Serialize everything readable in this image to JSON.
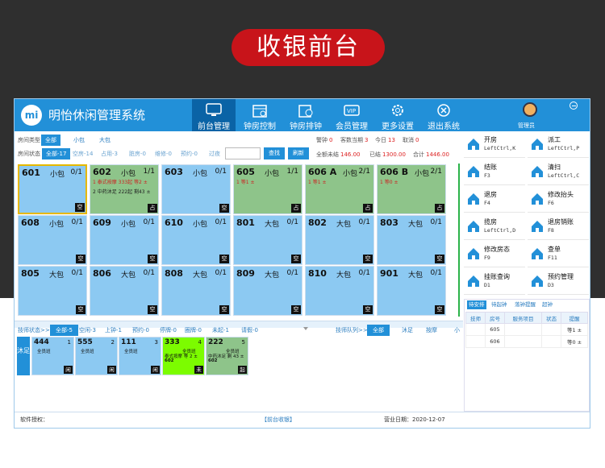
{
  "banner": "收银前台",
  "app": {
    "logo": "mi",
    "title": "明怡休闲管理系统",
    "manager": "管理员"
  },
  "nav": [
    {
      "label": "前台管理",
      "icon": "monitor-icon"
    },
    {
      "label": "钟房控制",
      "icon": "calendar-icon"
    },
    {
      "label": "钟房排钟",
      "icon": "schedule-icon"
    },
    {
      "label": "会员管理",
      "icon": "vip-icon"
    },
    {
      "label": "更多设置",
      "icon": "gear-icon"
    },
    {
      "label": "退出系统",
      "icon": "close-icon"
    }
  ],
  "filters": {
    "type_label": "房间类型",
    "types": [
      "全部",
      "小包",
      "大包"
    ],
    "status_label": "房间状态",
    "statuses": [
      "全部-17",
      "空房-14",
      "占用-3",
      "脏房-0",
      "维修-0",
      "预约-0",
      "过夜"
    ],
    "search_label": "查找",
    "refresh_label": "刷新",
    "alerts": [
      {
        "label": "警钟",
        "value": "0"
      },
      {
        "label": "客数当期",
        "value": "3"
      },
      {
        "label": "今日",
        "value": "13"
      },
      {
        "label": "取消",
        "value": "0"
      }
    ],
    "totals": [
      {
        "label": "全额未结",
        "value": "146.00"
      },
      {
        "label": "已结",
        "value": "1300.00"
      },
      {
        "label": "合计",
        "value": "1446.00"
      }
    ]
  },
  "rooms": [
    {
      "no": "601",
      "type": "小包",
      "cap": "0/1",
      "status": "空",
      "lines": []
    },
    {
      "no": "602",
      "type": "小包",
      "cap": "1/1",
      "status": "占",
      "lines": [
        {
          "text": "1 泰式按摩  333起  等2 ±",
          "red": true
        },
        {
          "text": "2 中药沐足  222起  剩43 ±",
          "red": false
        }
      ]
    },
    {
      "no": "603",
      "type": "小包",
      "cap": "0/1",
      "status": "空",
      "lines": []
    },
    {
      "no": "605",
      "type": "小包",
      "cap": "1/1",
      "status": "占",
      "lines": [
        {
          "text": "1 等1 ±",
          "red": true
        }
      ]
    },
    {
      "no": "606 A",
      "type": "小包",
      "cap": "2/1",
      "status": "占",
      "lines": [
        {
          "text": "1 等1 ±",
          "red": true
        }
      ]
    },
    {
      "no": "606 B",
      "type": "小包",
      "cap": "2/1",
      "status": "占",
      "lines": [
        {
          "text": "1 等0 ±",
          "red": true
        }
      ]
    },
    {
      "no": "608",
      "type": "小包",
      "cap": "0/1",
      "status": "空",
      "lines": []
    },
    {
      "no": "609",
      "type": "小包",
      "cap": "0/1",
      "status": "空",
      "lines": []
    },
    {
      "no": "610",
      "type": "小包",
      "cap": "0/1",
      "status": "空",
      "lines": []
    },
    {
      "no": "801",
      "type": "大包",
      "cap": "0/1",
      "status": "空",
      "lines": []
    },
    {
      "no": "802",
      "type": "大包",
      "cap": "0/1",
      "status": "空",
      "lines": []
    },
    {
      "no": "803",
      "type": "大包",
      "cap": "0/1",
      "status": "空",
      "lines": []
    },
    {
      "no": "805",
      "type": "大包",
      "cap": "0/1",
      "status": "空",
      "lines": []
    },
    {
      "no": "806",
      "type": "大包",
      "cap": "0/1",
      "status": "空",
      "lines": []
    },
    {
      "no": "808",
      "type": "大包",
      "cap": "0/1",
      "status": "空",
      "lines": []
    },
    {
      "no": "809",
      "type": "大包",
      "cap": "0/1",
      "status": "空",
      "lines": []
    },
    {
      "no": "810",
      "type": "大包",
      "cap": "0/1",
      "status": "空",
      "lines": []
    },
    {
      "no": "901",
      "type": "大包",
      "cap": "0/1",
      "status": "空",
      "lines": []
    }
  ],
  "actions": [
    {
      "name": "开房",
      "key": "LeftCtrl,K",
      "icon": "house-icon"
    },
    {
      "name": "派工",
      "key": "LeftCtrl,P",
      "icon": "worker-icon"
    },
    {
      "name": "结账",
      "key": "F3",
      "icon": "yen-icon"
    },
    {
      "name": "清扫",
      "key": "LeftCtrl,C",
      "icon": "broom-icon"
    },
    {
      "name": "退房",
      "key": "F4",
      "icon": "undo-icon"
    },
    {
      "name": "修改抬头",
      "key": "F6",
      "icon": "edit-icon"
    },
    {
      "name": "揽房",
      "key": "LeftCtrl,D",
      "icon": "handshake-icon"
    },
    {
      "name": "退房销账",
      "key": "F8",
      "icon": "house-user-icon"
    },
    {
      "name": "修改房态",
      "key": "F9",
      "icon": "house-edit-icon"
    },
    {
      "name": "查单",
      "key": "F11",
      "icon": "search-doc-icon"
    },
    {
      "name": "挂账查询",
      "key": "D1",
      "icon": "grid-icon"
    },
    {
      "name": "预约管理",
      "key": "D3",
      "icon": "book-icon"
    }
  ],
  "tech_filter": {
    "label": "技师状态>>",
    "statuses": [
      "全部-5",
      "空闲-3",
      "上钟-1",
      "预约-0",
      "停牌-0",
      "圈牌-0",
      "未起-1",
      "请假-0"
    ],
    "queue_label": "技师队列>>",
    "queue_tabs": [
      "全部",
      "沐足",
      "按摩",
      "小"
    ]
  },
  "tech_group": "沐足",
  "techs": [
    {
      "no": "444",
      "idx": "1",
      "group": "全员班",
      "line1": "",
      "line2": "",
      "status": "闲",
      "kind": "idle"
    },
    {
      "no": "555",
      "idx": "2",
      "group": "全员班",
      "line1": "",
      "line2": "",
      "status": "闲",
      "kind": "idle"
    },
    {
      "no": "111",
      "idx": "3",
      "group": "全员班",
      "line1": "",
      "line2": "",
      "status": "闲",
      "kind": "idle"
    },
    {
      "no": "333",
      "idx": "4",
      "group": "全员班",
      "line1": "泰式按摩 等 2 ±",
      "line2": "602",
      "status": "未",
      "kind": "busy"
    },
    {
      "no": "222",
      "idx": "5",
      "group": "全员班",
      "line1": "中药沐足 剩 43 ±",
      "line2": "602",
      "status": "起",
      "kind": "done"
    }
  ],
  "right_tabs": [
    "待安排",
    "待起钟",
    "落钟提醒",
    "超钟"
  ],
  "orders": {
    "headers": [
      "技师",
      "房号",
      "服务项目",
      "状态",
      "提醒"
    ],
    "rows": [
      [
        "",
        "605",
        "",
        "",
        "等1 ±"
      ],
      [
        "",
        "606",
        "",
        "",
        "等0 ±"
      ]
    ]
  },
  "footer": {
    "license": "软件授权：",
    "module": "【前台收银】",
    "date": "营业日期：2020-12-07"
  }
}
